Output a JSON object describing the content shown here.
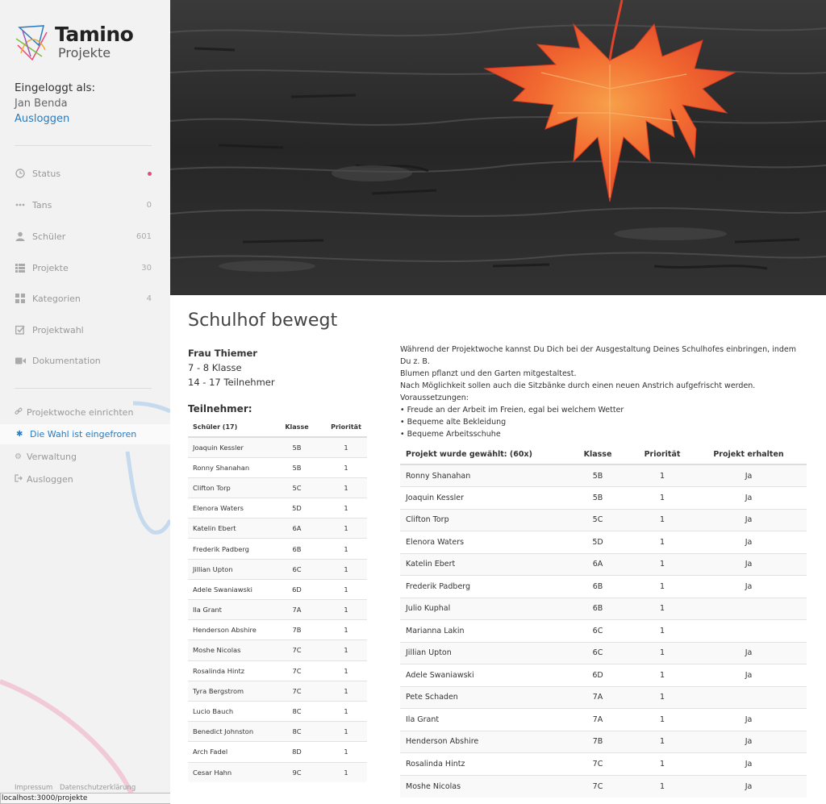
{
  "brand": {
    "name": "Tamino",
    "subtitle": "Projekte"
  },
  "login": {
    "label": "Eingeloggt als:",
    "user": "Jan Benda",
    "logout": "Ausloggen"
  },
  "nav": [
    {
      "label": "Status",
      "count": "",
      "icon": "clock-icon"
    },
    {
      "label": "Tans",
      "count": "0",
      "icon": "dots-icon"
    },
    {
      "label": "Schüler",
      "count": "601",
      "icon": "user-icon"
    },
    {
      "label": "Projekte",
      "count": "30",
      "icon": "list-icon"
    },
    {
      "label": "Kategorien",
      "count": "4",
      "icon": "grid-icon"
    },
    {
      "label": "Projektwahl",
      "count": "",
      "icon": "checkbox-icon"
    },
    {
      "label": "Dokumentation",
      "count": "",
      "icon": "video-icon"
    }
  ],
  "links": [
    {
      "label": "Projektwoche einrichten",
      "icon": "link-icon"
    },
    {
      "label": "Die Wahl ist eingefroren",
      "icon": "snowflake-icon"
    },
    {
      "label": "Verwaltung",
      "icon": "gear-icon"
    },
    {
      "label": "Ausloggen",
      "icon": "signout-icon"
    }
  ],
  "footer": {
    "impressum": "Impressum",
    "datenschutz": "Datenschutzerklärung"
  },
  "status_url": "localhost:3000/projekte",
  "project": {
    "title": "Schulhof bewegt",
    "teacher": "Frau Thiemer",
    "grades": "7 - 8 Klasse",
    "participants": "14 - 17 Teilnehmer",
    "description": [
      "Während der Projektwoche kannst Du Dich bei der Ausgestaltung Deines Schulhofes einbringen, indem Du z. B.",
      "Blumen pflanzt und den Garten mitgestaltest.",
      "Nach Möglichkeit sollen auch die Sitzbänke durch einen neuen Anstrich aufgefrischt werden.",
      "Voraussetzungen:",
      "• Freude an der Arbeit im Freien, egal bei welchem Wetter",
      "• Bequeme alte Bekleidung",
      "• Bequeme Arbeitsschuhe"
    ]
  },
  "participants_table": {
    "heading": "Teilnehmer:",
    "columns": [
      "Schüler (17)",
      "Klasse",
      "Priorität"
    ],
    "rows": [
      [
        "Joaquin Kessler",
        "5B",
        "1"
      ],
      [
        "Ronny Shanahan",
        "5B",
        "1"
      ],
      [
        "Clifton Torp",
        "5C",
        "1"
      ],
      [
        "Elenora Waters",
        "5D",
        "1"
      ],
      [
        "Katelin Ebert",
        "6A",
        "1"
      ],
      [
        "Frederik Padberg",
        "6B",
        "1"
      ],
      [
        "Jillian Upton",
        "6C",
        "1"
      ],
      [
        "Adele Swaniawski",
        "6D",
        "1"
      ],
      [
        "Ila Grant",
        "7A",
        "1"
      ],
      [
        "Henderson Abshire",
        "7B",
        "1"
      ],
      [
        "Moshe Nicolas",
        "7C",
        "1"
      ],
      [
        "Rosalinda Hintz",
        "7C",
        "1"
      ],
      [
        "Tyra Bergstrom",
        "7C",
        "1"
      ],
      [
        "Lucio Bauch",
        "8C",
        "1"
      ],
      [
        "Benedict Johnston",
        "8C",
        "1"
      ],
      [
        "Arch Fadel",
        "8D",
        "1"
      ],
      [
        "Cesar Hahn",
        "9C",
        "1"
      ]
    ]
  },
  "choices_table": {
    "columns": [
      "Projekt wurde gewählt: (60x)",
      "Klasse",
      "Priorität",
      "Projekt erhalten"
    ],
    "rows": [
      [
        "Ronny Shanahan",
        "5B",
        "1",
        "Ja"
      ],
      [
        "Joaquin Kessler",
        "5B",
        "1",
        "Ja"
      ],
      [
        "Clifton Torp",
        "5C",
        "1",
        "Ja"
      ],
      [
        "Elenora Waters",
        "5D",
        "1",
        "Ja"
      ],
      [
        "Katelin Ebert",
        "6A",
        "1",
        "Ja"
      ],
      [
        "Frederik Padberg",
        "6B",
        "1",
        "Ja"
      ],
      [
        "Julio Kuphal",
        "6B",
        "1",
        ""
      ],
      [
        "Marianna Lakin",
        "6C",
        "1",
        ""
      ],
      [
        "Jillian Upton",
        "6C",
        "1",
        "Ja"
      ],
      [
        "Adele Swaniawski",
        "6D",
        "1",
        "Ja"
      ],
      [
        "Pete Schaden",
        "7A",
        "1",
        ""
      ],
      [
        "Ila Grant",
        "7A",
        "1",
        "Ja"
      ],
      [
        "Henderson Abshire",
        "7B",
        "1",
        "Ja"
      ],
      [
        "Rosalinda Hintz",
        "7C",
        "1",
        "Ja"
      ],
      [
        "Moshe Nicolas",
        "7C",
        "1",
        "Ja"
      ]
    ]
  },
  "colors": {
    "accent": "#2a7ac0",
    "status_dot": "#e64a7b",
    "sidebar_bg": "#f2f2f2",
    "leaf": "#f05a2a"
  }
}
